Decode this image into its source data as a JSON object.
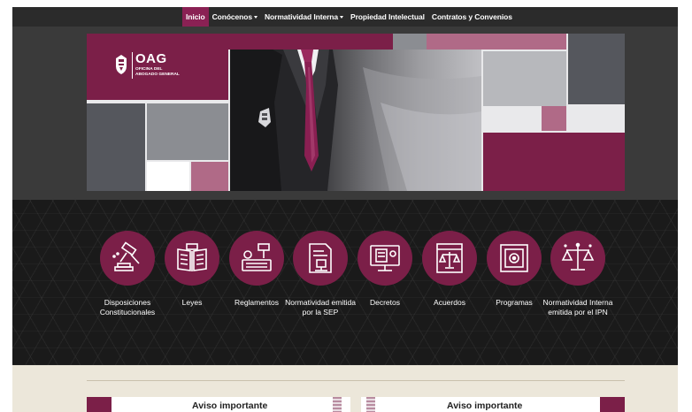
{
  "navbar": {
    "items": [
      {
        "label": "Inicio",
        "active": true,
        "dropdown": false
      },
      {
        "label": "Conócenos",
        "active": false,
        "dropdown": true
      },
      {
        "label": "Normatividad Interna",
        "active": false,
        "dropdown": true
      },
      {
        "label": "Propiedad Intelectual",
        "active": false,
        "dropdown": false
      },
      {
        "label": "Contratos y Convenios",
        "active": false,
        "dropdown": false
      }
    ]
  },
  "banner": {
    "acronym": "OAG",
    "subtitle_line1": "OFICINA DEL",
    "subtitle_line2": "ABOGADO GENERAL"
  },
  "categories": [
    {
      "label": "Disposiciones Constitucionales",
      "icon": "gavel-icon"
    },
    {
      "label": "Leyes",
      "icon": "open-book-icon"
    },
    {
      "label": "Reglamentos",
      "icon": "typewriter-gavel-icon"
    },
    {
      "label": "Normatividad emitida por la SEP",
      "icon": "document-stamp-icon"
    },
    {
      "label": "Decretos",
      "icon": "computer-document-icon"
    },
    {
      "label": "Acuerdos",
      "icon": "scales-window-icon"
    },
    {
      "label": "Programas",
      "icon": "program-screen-icon"
    },
    {
      "label": "Normatividad Interna emitida por el IPN",
      "icon": "justice-scales-icon"
    }
  ],
  "notices": [
    {
      "title": "Aviso importante"
    },
    {
      "title": "Aviso importante"
    }
  ],
  "colors": {
    "brand_maroon": "#7b1f48",
    "navbar_bg": "#2b2b2b",
    "active_nav": "#8a2154",
    "icons_band_bg": "#1a1a1a",
    "bottom_bg": "#ece7da"
  }
}
